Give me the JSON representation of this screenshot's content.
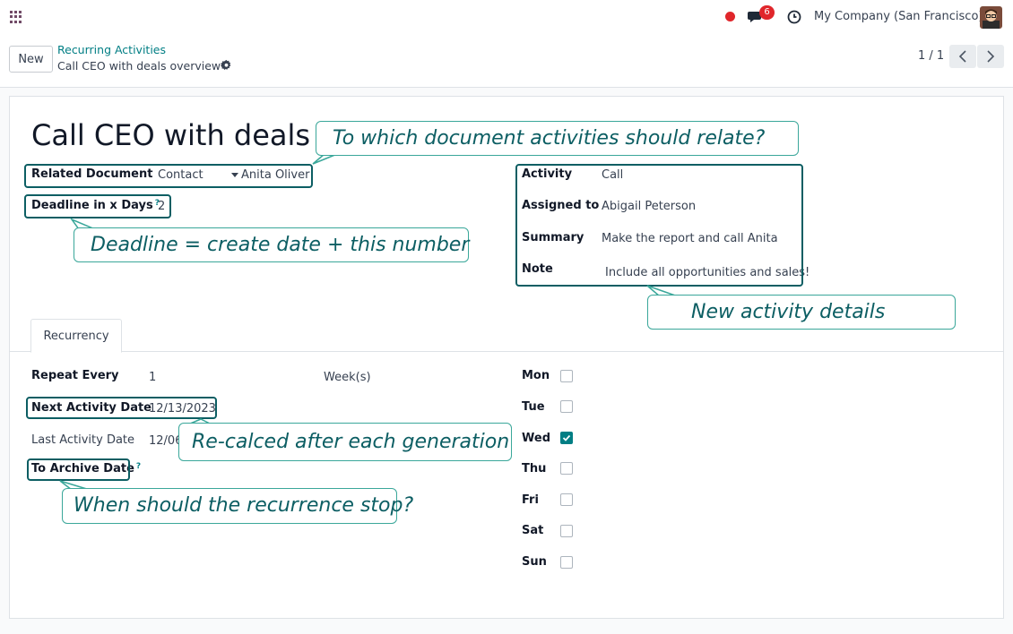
{
  "navbar": {
    "apps_icon": "apps-grid-icon",
    "messages_badge": "6",
    "company": "My Company (San Francisco)"
  },
  "control": {
    "new_label": "New",
    "breadcrumb_parent": "Recurring Activities",
    "breadcrumb_current": "Call CEO with deals overview",
    "pager": "1 / 1"
  },
  "record": {
    "title": "Call CEO with deals overview",
    "related_document_label": "Related Document",
    "related_model": "Contact",
    "related_record": "Anita Oliver",
    "deadline_label": "Deadline in x Days",
    "deadline_value": "2",
    "help_mark": "?",
    "activity_label": "Activity",
    "activity_value": "Call",
    "assigned_label": "Assigned to",
    "assigned_value": "Abigail Peterson",
    "summary_label": "Summary",
    "summary_value": "Make the report and call Anita",
    "note_label": "Note",
    "note_value": "Include all opportunities and sales!"
  },
  "tabs": [
    {
      "label": "Recurrency",
      "active": true
    }
  ],
  "recurrency": {
    "repeat_label": "Repeat Every",
    "repeat_value": "1",
    "repeat_unit": "Week(s)",
    "next_label": "Next Activity Date",
    "next_value": "12/13/2023",
    "last_label": "Last Activity Date",
    "last_value": "12/06",
    "archive_label": "To Archive Date",
    "days": [
      {
        "label": "Mon",
        "checked": false
      },
      {
        "label": "Tue",
        "checked": false
      },
      {
        "label": "Wed",
        "checked": true
      },
      {
        "label": "Thu",
        "checked": false
      },
      {
        "label": "Fri",
        "checked": false
      },
      {
        "label": "Sat",
        "checked": false
      },
      {
        "label": "Sun",
        "checked": false
      }
    ]
  },
  "callouts": {
    "relate": "To which document activities should relate?",
    "deadline": "Deadline = create date + this number",
    "details": "New activity details",
    "recalc": "Re-calced after each generation",
    "stop": "When should the recurrence stop?"
  },
  "colors": {
    "accent": "#017e84",
    "highlight": "#0c5e63",
    "callout_border": "#3aa79a",
    "danger": "#e0262b"
  }
}
